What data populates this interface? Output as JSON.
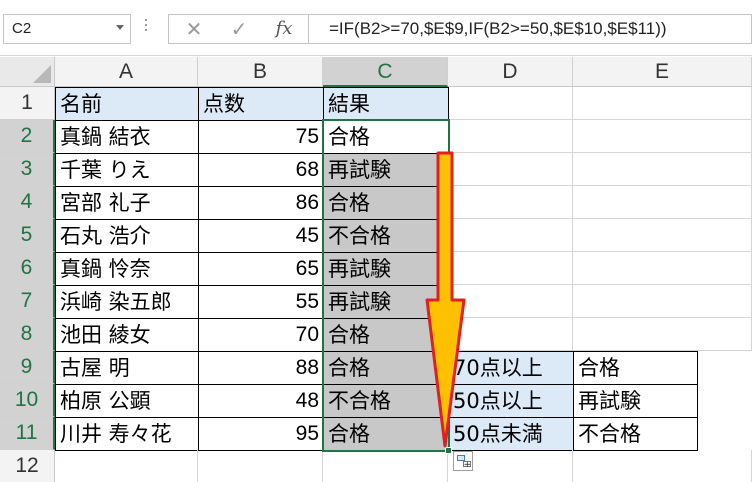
{
  "formula_bar": {
    "name_box": "C2",
    "cancel_glyph": "✕",
    "enter_glyph": "✓",
    "fx_label": "fx",
    "formula": "=IF(B2>=70,$E$9,IF(B2>=50,$E$10,$E$11))"
  },
  "columns": [
    "A",
    "B",
    "C",
    "D",
    "E"
  ],
  "rows": [
    "1",
    "2",
    "3",
    "4",
    "5",
    "6",
    "7",
    "8",
    "9",
    "10",
    "11",
    "12"
  ],
  "headers": {
    "name": "名前",
    "score": "点数",
    "result": "結果"
  },
  "records": [
    {
      "name": "真鍋 結衣",
      "score": "75",
      "result": "合格"
    },
    {
      "name": "千葉 りえ",
      "score": "68",
      "result": "再試験"
    },
    {
      "name": "宮部 礼子",
      "score": "86",
      "result": "合格"
    },
    {
      "name": "石丸 浩介",
      "score": "45",
      "result": "不合格"
    },
    {
      "name": "真鍋 怜奈",
      "score": "65",
      "result": "再試験"
    },
    {
      "name": "浜崎 染五郎",
      "score": "55",
      "result": "再試験"
    },
    {
      "name": "池田 綾女",
      "score": "70",
      "result": "合格"
    },
    {
      "name": "古屋 明",
      "score": "88",
      "result": "合格"
    },
    {
      "name": "柏原 公顕",
      "score": "48",
      "result": "不合格"
    },
    {
      "name": "川井 寿々花",
      "score": "95",
      "result": "合格"
    }
  ],
  "criteria": [
    {
      "condition": "70点以上",
      "grade": "合格"
    },
    {
      "condition": "50点以上",
      "grade": "再試験"
    },
    {
      "condition": "50点未満",
      "grade": "不合格"
    }
  ],
  "colors": {
    "header_fill": "#dce9f6",
    "selection": "#217346",
    "arrow_fill": "#ffc000",
    "arrow_stroke": "#e02020"
  },
  "icons": {
    "autofill_options": "autofill-options-icon"
  }
}
